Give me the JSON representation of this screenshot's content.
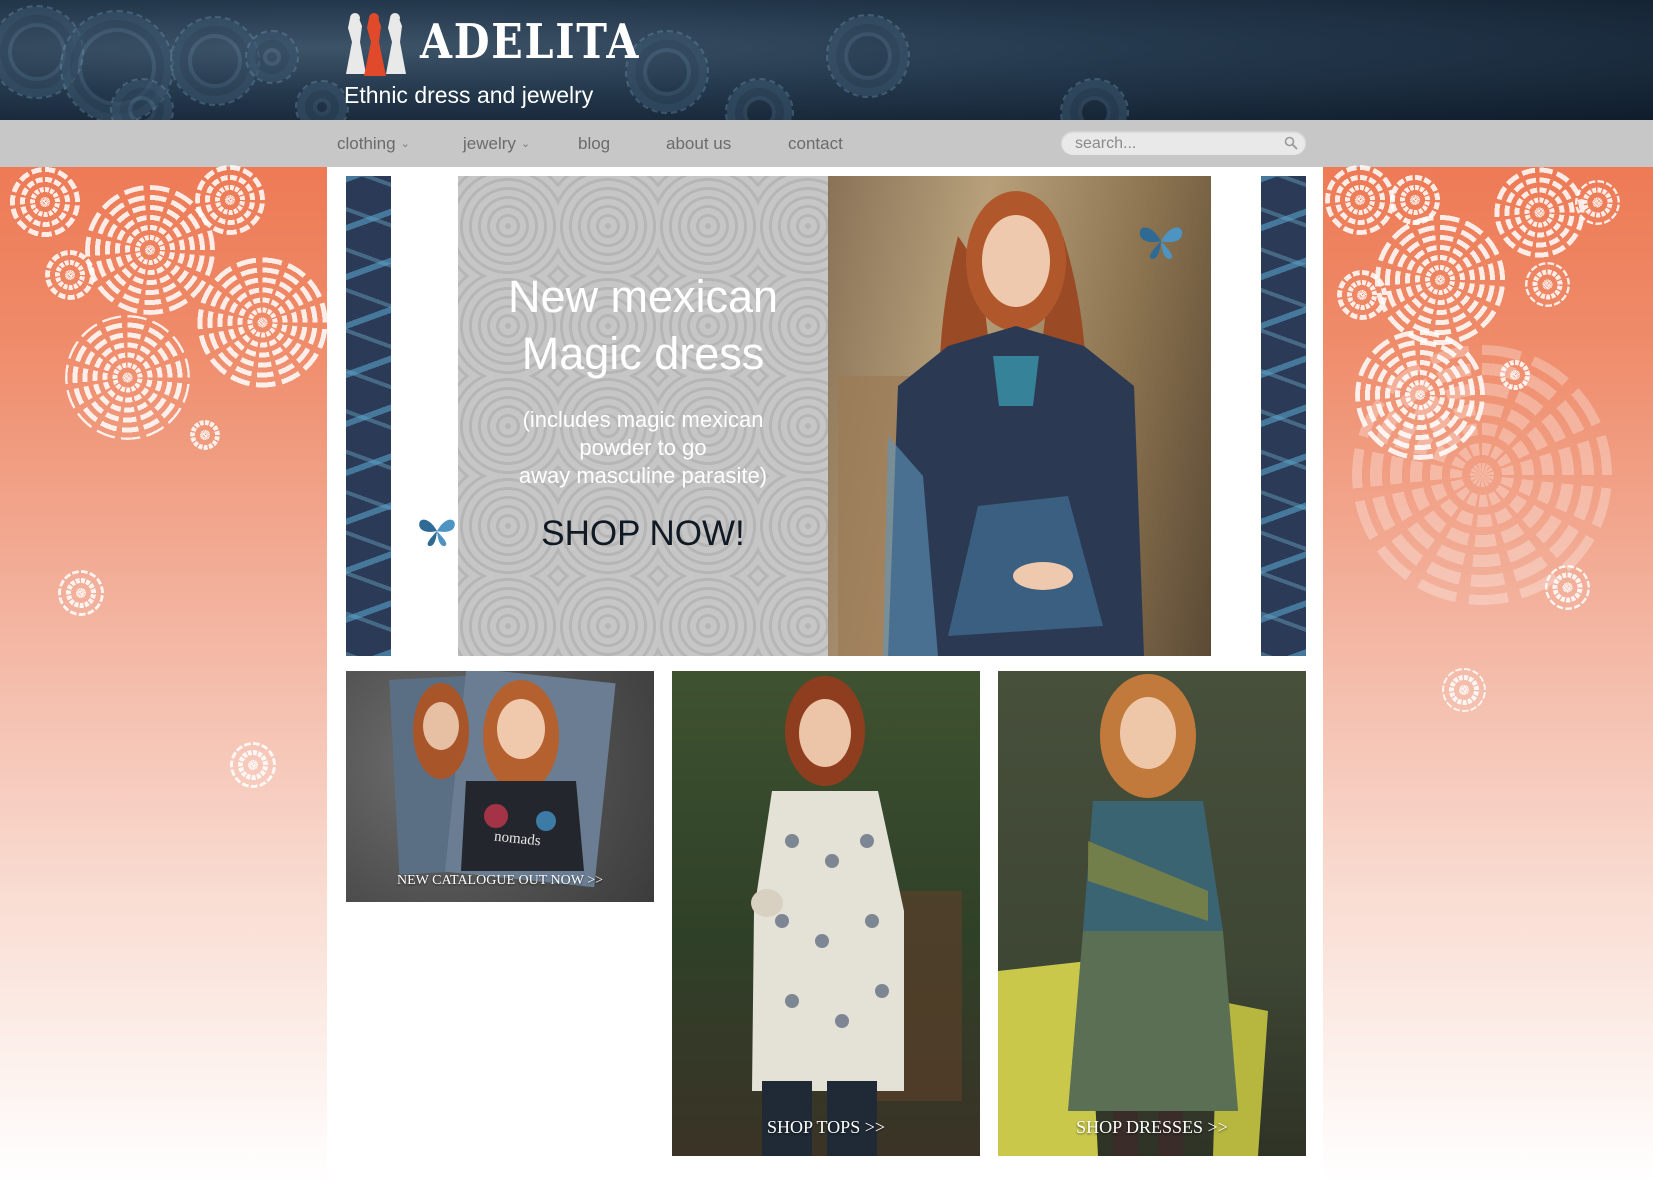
{
  "brand": {
    "logo_text": "ADELITA",
    "tagline": "Ethnic dress and jewelry"
  },
  "nav": {
    "items": [
      {
        "label": "clothing",
        "has_dropdown": true
      },
      {
        "label": "jewelry",
        "has_dropdown": true
      },
      {
        "label": "blog",
        "has_dropdown": false
      },
      {
        "label": "about us",
        "has_dropdown": false
      },
      {
        "label": "contact",
        "has_dropdown": false
      }
    ],
    "search_placeholder": "search...",
    "dropdown_glyph": "⌄"
  },
  "hero": {
    "headline_line1": "New mexican",
    "headline_line2": "Magic dress",
    "sub_line1": "(includes magic mexican",
    "sub_line2": "powder to go",
    "sub_line3": "away masculine parasite)",
    "cta": "SHOP NOW!"
  },
  "tiles": {
    "catalogue": {
      "label": "NEW CATALOGUE OUT NOW >>",
      "print_text": "nomads"
    },
    "tops": {
      "label": "SHOP TOPS >>"
    },
    "dresses": {
      "label": "SHOP DRESSES >>"
    }
  },
  "colors": {
    "header_bg": "#1b2d40",
    "nav_bg": "#c7c7c7",
    "nav_text": "#6b6b6b",
    "side_accent": "#ec6a43",
    "logo_red": "#e0492a",
    "cta_text": "#111a24"
  },
  "icons": {
    "search": "search-icon",
    "dropdown": "chevron-down-icon"
  }
}
